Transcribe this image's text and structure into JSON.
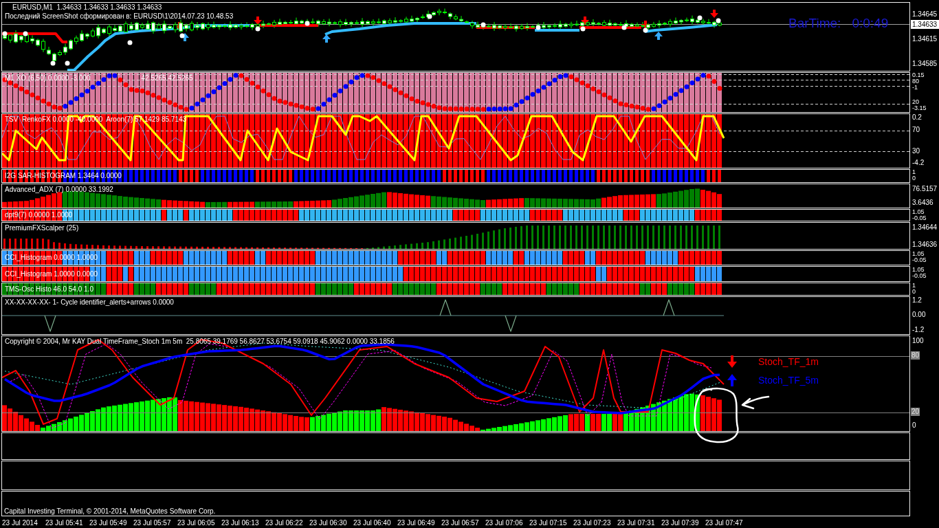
{
  "main_chart": {
    "symbol_line": "EURUSD,M1  1.34633 1.34633 1.34633 1.34633",
    "screenshot_line": "Последний ScreenShot сформирован в: EURUSD\\1\\2014.07.23 10.48.53",
    "bar_time_label": "BarTime:",
    "bar_time_value": "0:0:49",
    "scale": [
      "1.34645",
      "1.34615",
      "1.34585"
    ],
    "current_price": "1.34633"
  },
  "panes": [
    {
      "kind": "dots",
      "label": "M1 XO (6,50) 0.0000 -3.000",
      "label_tail": "42.5265 42.5265",
      "scale": [
        "0.15",
        "80",
        "-1",
        "20",
        "-3.15"
      ]
    },
    {
      "kind": "oscillator",
      "label": "TSV  RenkoFX 0.0000 -40.0000  Aroon(7) 57.1429 85.7143",
      "scale": [
        "0.2",
        "70",
        "30",
        "-4.2"
      ]
    },
    {
      "kind": "color-bars",
      "label": "I2G SAR-HISTOGRAM 1.3464 0.0000",
      "scale": [
        "1",
        "0"
      ]
    },
    {
      "kind": "height-bars",
      "label": "Advanced_ADX (7) 0.0000 33.1992",
      "scale": [
        "76.5157",
        "3.6436"
      ]
    },
    {
      "kind": "color-bars",
      "label": "dpt9(7) 0.0000 1.0000",
      "scale": [
        "1.05",
        "-0.05"
      ]
    },
    {
      "kind": "thin-bars",
      "label": "PremiumFXScalper (25)",
      "scale": [
        "1.34644",
        "1.34636"
      ]
    },
    {
      "kind": "color-bars",
      "label": "CCI_Histogram 0.0000 1.0000",
      "scale": [
        "1.05",
        "-0.05"
      ]
    },
    {
      "kind": "color-bars",
      "label": "CCI_Histogram 1.0000 0.0000",
      "scale": [
        "1.05",
        "-0.05"
      ]
    },
    {
      "kind": "color-bars",
      "label": "TMS-Osc Histo 46.0 54.0 1.0",
      "scale": [
        "1",
        "0"
      ]
    },
    {
      "kind": "spike-line",
      "label": "XX-XX-XX-XX- 1- Cycle identifier_alerts+arrows 0.0000",
      "scale": [
        "1.2",
        "0.00",
        "-1.2"
      ]
    },
    {
      "kind": "stochastic",
      "label": "Copyright © 2004, Mr KAY Dual TimeFrame_Stoch 1m 5m  25.8065 39.1769 56.8627 53.6754 59.0918 45.9062 0.0000 33.1856",
      "scale": [
        "100",
        "0"
      ],
      "level_labels": [
        "80",
        "20"
      ],
      "legend": [
        {
          "kind": "down-arrow",
          "text": "Stoch_TF_1m",
          "color": "#ff0000"
        },
        {
          "kind": "up-arrow",
          "text": "Stoch_TF_5m",
          "color": "#0000ff"
        }
      ]
    }
  ],
  "footer": {
    "caption": "Capital Investing Terminal, © 2001-2014, MetaQuotes Software Corp."
  },
  "time_axis": [
    "23 Jul 2014",
    "23 Jul 05:41",
    "23 Jul 05:49",
    "23 Jul 05:57",
    "23 Jul 06:05",
    "23 Jul 06:13",
    "23 Jul 06:22",
    "23 Jul 06:30",
    "23 Jul 06:40",
    "23 Jul 06:49",
    "23 Jul 06:57",
    "23 Jul 07:06",
    "23 Jul 07:15",
    "23 Jul 07:23",
    "23 Jul 07:31",
    "23 Jul 07:39",
    "23 Jul 07:47"
  ]
}
